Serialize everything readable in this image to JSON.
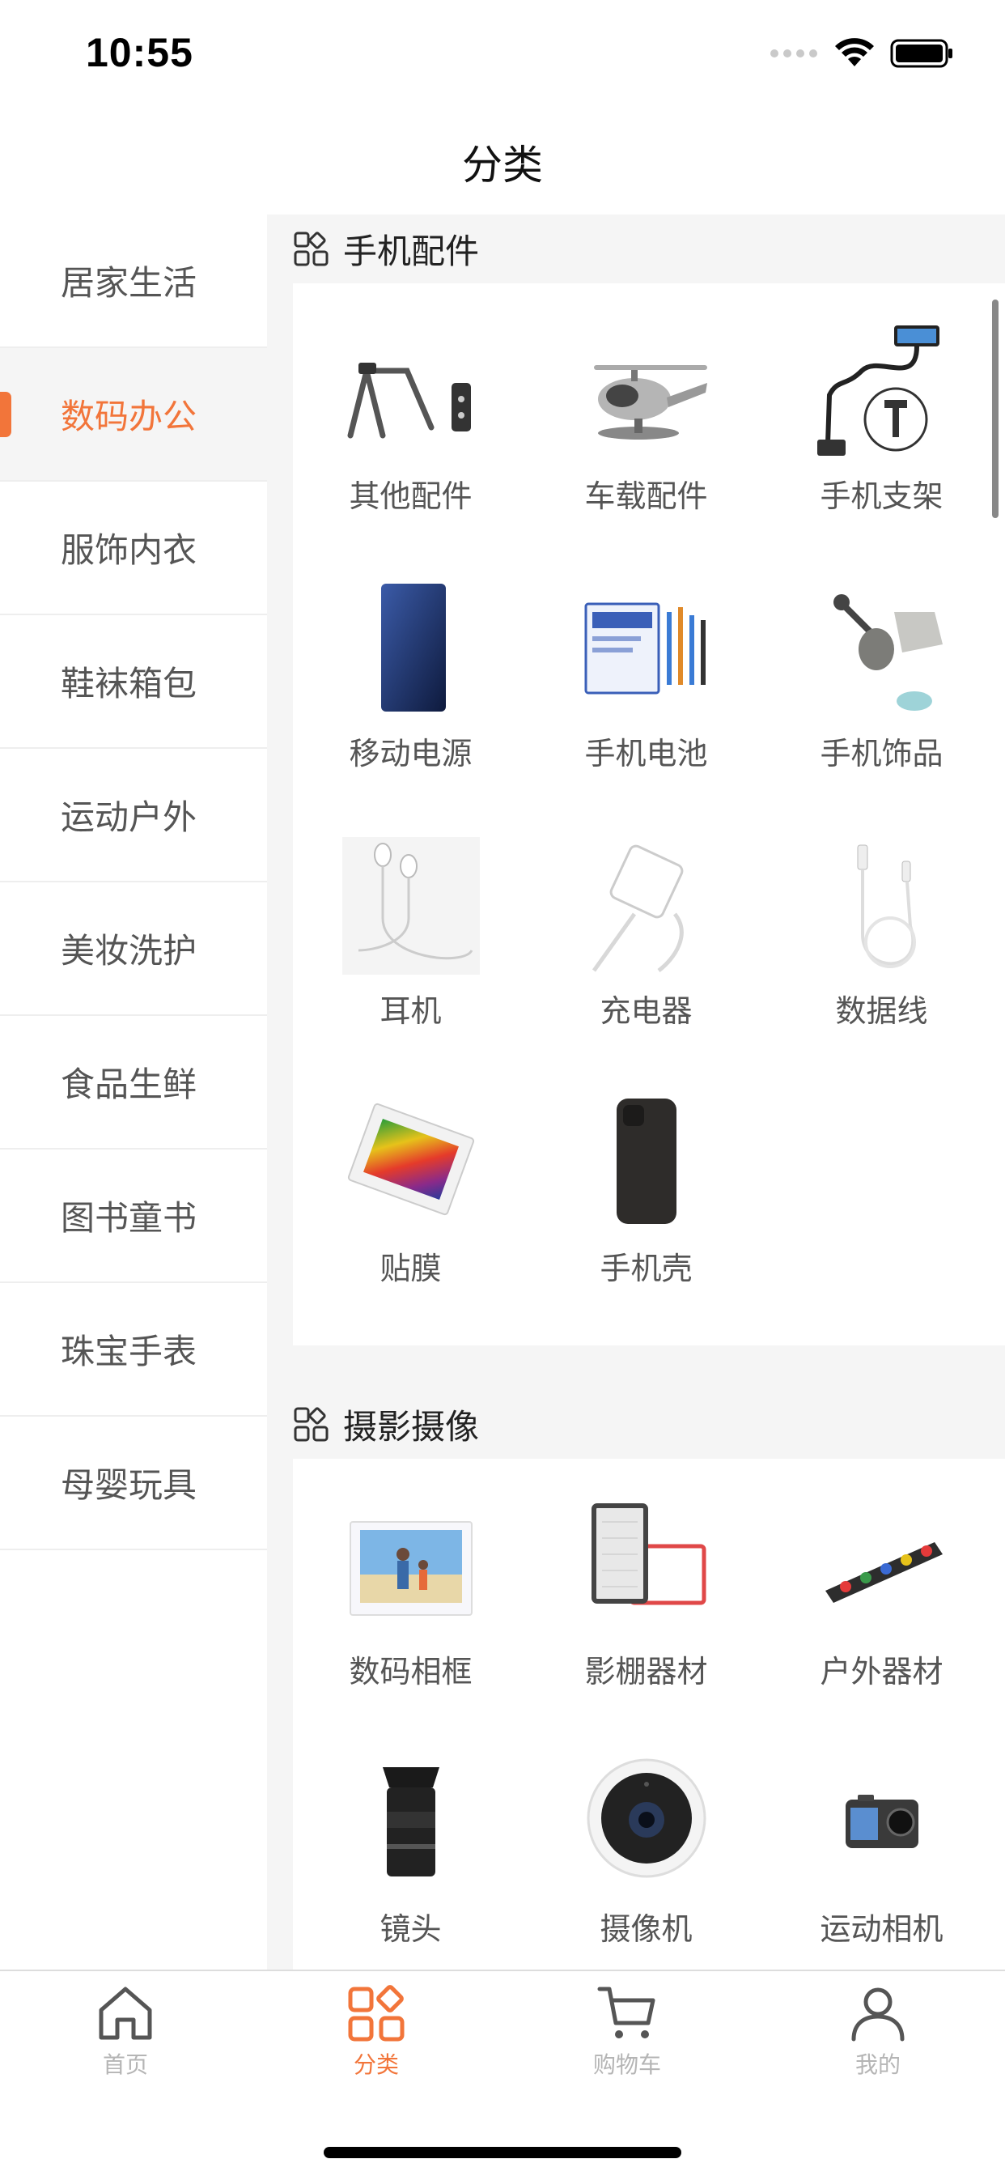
{
  "status_bar": {
    "time": "10:55"
  },
  "nav": {
    "title": "分类"
  },
  "sidebar": {
    "items": [
      {
        "label": "居家生活"
      },
      {
        "label": "数码办公",
        "active": true
      },
      {
        "label": "服饰内衣"
      },
      {
        "label": "鞋袜箱包"
      },
      {
        "label": "运动户外"
      },
      {
        "label": "美妆洗护"
      },
      {
        "label": "食品生鲜"
      },
      {
        "label": "图书童书"
      },
      {
        "label": "珠宝手表"
      },
      {
        "label": "母婴玩具"
      }
    ]
  },
  "sections": [
    {
      "title": "手机配件",
      "items": [
        {
          "label": "其他配件",
          "icon": "phone-stand-accessory-image"
        },
        {
          "label": "车载配件",
          "icon": "car-ornament-image"
        },
        {
          "label": "手机支架",
          "icon": "gooseneck-holder-image"
        },
        {
          "label": "移动电源",
          "icon": "power-bank-image"
        },
        {
          "label": "手机电池",
          "icon": "battery-kit-image"
        },
        {
          "label": "手机饰品",
          "icon": "dust-plug-image"
        },
        {
          "label": "耳机",
          "icon": "earphones-image"
        },
        {
          "label": "充电器",
          "icon": "charger-image"
        },
        {
          "label": "数据线",
          "icon": "data-cable-image"
        },
        {
          "label": "贴膜",
          "icon": "screen-film-image"
        },
        {
          "label": "手机壳",
          "icon": "phone-case-image"
        }
      ]
    },
    {
      "title": "摄影摄像",
      "items": [
        {
          "label": "数码相框",
          "icon": "photo-frame-image"
        },
        {
          "label": "影棚器材",
          "icon": "led-panel-image"
        },
        {
          "label": "户外器材",
          "icon": "outdoor-board-image"
        },
        {
          "label": "镜头",
          "icon": "lens-image"
        },
        {
          "label": "摄像机",
          "icon": "webcam-image"
        },
        {
          "label": "运动相机",
          "icon": "action-camera-image"
        }
      ]
    }
  ],
  "tabbar": {
    "tabs": [
      {
        "label": "首页",
        "icon": "home-icon"
      },
      {
        "label": "分类",
        "icon": "category-icon",
        "active": true
      },
      {
        "label": "购物车",
        "icon": "cart-icon"
      },
      {
        "label": "我的",
        "icon": "user-icon"
      }
    ]
  },
  "colors": {
    "accent": "#f2753a",
    "background": "#f5f5f5",
    "text": "#555555"
  }
}
